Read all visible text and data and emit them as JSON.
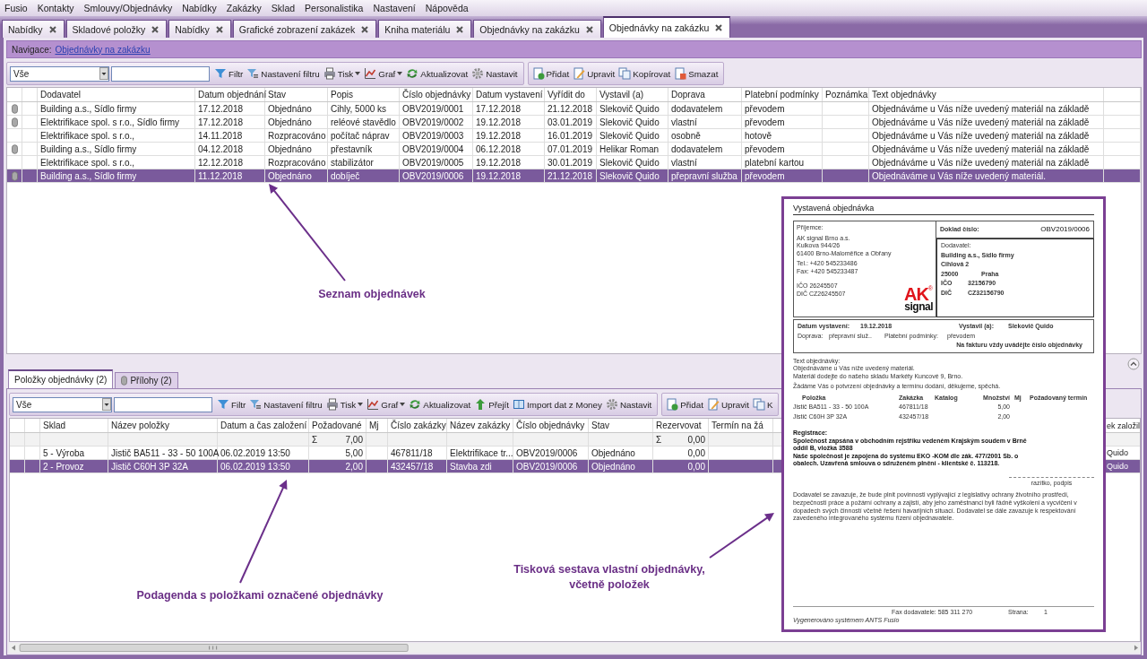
{
  "menu": [
    "Fusio",
    "Kontakty",
    "Smlouvy/Objednávky",
    "Nabídky",
    "Zakázky",
    "Sklad",
    "Personalistika",
    "Nastavení",
    "Nápověda"
  ],
  "tabs": [
    {
      "label": "Nabídky",
      "selected": false
    },
    {
      "label": "Skladové položky",
      "selected": false
    },
    {
      "label": "Nabídky",
      "selected": false
    },
    {
      "label": "Grafické zobrazení zakázek",
      "selected": false
    },
    {
      "label": "Kniha materiálu",
      "selected": false
    },
    {
      "label": "Objednávky na zakázku",
      "selected": false
    },
    {
      "label": "Objednávky na zakázku",
      "selected": true
    }
  ],
  "navigation": {
    "label": "Navigace:",
    "link": "Objednávky na zakázku"
  },
  "toolbar": {
    "filter_value": "Vše",
    "groups": [
      [
        {
          "label": "Filtr",
          "kind": "filter",
          "dropdown": false
        },
        {
          "label": "Nastavení filtru",
          "kind": "filter_settings",
          "dropdown": false
        },
        {
          "label": "Tisk",
          "kind": "print",
          "dropdown": true
        },
        {
          "label": "Graf",
          "kind": "chart",
          "dropdown": true
        },
        {
          "label": "Aktualizovat",
          "kind": "refresh",
          "dropdown": false
        },
        {
          "label": "Nastavit",
          "kind": "settings",
          "dropdown": false
        }
      ],
      [
        {
          "label": "Přidat",
          "kind": "add",
          "dropdown": false
        },
        {
          "label": "Upravit",
          "kind": "edit",
          "dropdown": false
        },
        {
          "label": "Kopírovat",
          "kind": "copy",
          "dropdown": false
        },
        {
          "label": "Smazat",
          "kind": "delete",
          "dropdown": false
        }
      ]
    ]
  },
  "orders": {
    "columns": [
      "Dodavatel",
      "Datum objednání",
      "Stav",
      "Popis",
      "Číslo objednávky",
      "Datum vystavení",
      "Vyřídit do",
      "Vystavil (a)",
      "Doprava",
      "Platební podmínky",
      "Poznámka",
      "Text objednávky"
    ],
    "rows": [
      {
        "attachment": true,
        "selected": false,
        "dodavatel": "Building a.s., Sídlo firmy",
        "datum_objednani": "17.12.2018",
        "stav": "Objednáno",
        "popis": "Cihly, 5000 ks",
        "cislo_objednavky": "OBV2019/0001",
        "datum_vystaveni": "17.12.2018",
        "vyridit_do": "21.12.2018",
        "vystavil": "Slekovič Quido",
        "doprava": "dodavatelem",
        "platebni_podminky": "převodem",
        "text_objednavky": "Objednáváme u Vás níže uvedený materiál na základě"
      },
      {
        "attachment": true,
        "selected": false,
        "dodavatel": "Elektrifikace spol. s r.o., Sídlo firmy",
        "datum_objednani": "17.12.2018",
        "stav": "Objednáno",
        "popis": "reléové stavědlo",
        "cislo_objednavky": "OBV2019/0002",
        "datum_vystaveni": "19.12.2018",
        "vyridit_do": "03.01.2019",
        "vystavil": "Slekovič Quido",
        "doprava": "vlastní",
        "platebni_podminky": "převodem",
        "text_objednavky": "Objednáváme u Vás níže uvedený materiál na základě"
      },
      {
        "attachment": false,
        "selected": false,
        "dodavatel": "Elektrifikace spol. s r.o.,",
        "datum_objednani": "14.11.2018",
        "stav": "Rozpracováno",
        "popis": "počítač náprav",
        "cislo_objednavky": "OBV2019/0003",
        "datum_vystaveni": "19.12.2018",
        "vyridit_do": "16.01.2019",
        "vystavil": "Slekovič Quido",
        "doprava": "osobně",
        "platebni_podminky": "hotově",
        "text_objednavky": "Objednáváme u Vás níže uvedený materiál na základě"
      },
      {
        "attachment": true,
        "selected": false,
        "dodavatel": "Building a.s., Sídlo firmy",
        "datum_objednani": "04.12.2018",
        "stav": "Objednáno",
        "popis": "přestavník",
        "cislo_objednavky": "OBV2019/0004",
        "datum_vystaveni": "06.12.2018",
        "vyridit_do": "07.01.2019",
        "vystavil": "Helikar Roman",
        "doprava": "dodavatelem",
        "platebni_podminky": "převodem",
        "text_objednavky": "Objednáváme u Vás níže uvedený materiál na základě"
      },
      {
        "attachment": false,
        "selected": false,
        "dodavatel": "Elektrifikace spol. s r.o.,",
        "datum_objednani": "12.12.2018",
        "stav": "Rozpracováno",
        "popis": "stabilizátor",
        "cislo_objednavky": "OBV2019/0005",
        "datum_vystaveni": "19.12.2018",
        "vyridit_do": "30.01.2019",
        "vystavil": "Slekovič Quido",
        "doprava": "vlastní",
        "platebni_podminky": "platební kartou",
        "text_objednavky": "Objednáváme u Vás níže uvedený materiál na základě"
      },
      {
        "attachment": true,
        "selected": true,
        "dodavatel": "Building a.s., Sídlo firmy",
        "datum_objednani": "11.12.2018",
        "stav": "Objednáno",
        "popis": "dobíječ",
        "cislo_objednavky": "OBV2019/0006",
        "datum_vystaveni": "19.12.2018",
        "vyridit_do": "21.12.2018",
        "vystavil": "Slekovič Quido",
        "doprava": "přepravní služba",
        "platebni_podminky": "převodem",
        "text_objednavky": "Objednáváme u Vás níže uvedený materiál."
      }
    ]
  },
  "detail_tabs": [
    {
      "label": "Položky objednávky (2)",
      "selected": true,
      "attachment": false
    },
    {
      "label": "Přílohy (2)",
      "selected": false,
      "attachment": true
    }
  ],
  "detail_toolbar": {
    "filter_value": "Vše",
    "groups": [
      [
        {
          "label": "Filtr",
          "kind": "filter",
          "dropdown": false
        },
        {
          "label": "Nastavení filtru",
          "kind": "filter_settings",
          "dropdown": false
        },
        {
          "label": "Tisk",
          "kind": "print",
          "dropdown": true
        },
        {
          "label": "Graf",
          "kind": "chart",
          "dropdown": true
        },
        {
          "label": "Aktualizovat",
          "kind": "refresh",
          "dropdown": false
        },
        {
          "label": "Přejít",
          "kind": "go",
          "dropdown": false
        },
        {
          "label": "Import dat z Money",
          "kind": "import",
          "dropdown": false
        },
        {
          "label": "Nastavit",
          "kind": "settings",
          "dropdown": false
        }
      ],
      [
        {
          "label": "Přidat",
          "kind": "add",
          "dropdown": false
        },
        {
          "label": "Upravit",
          "kind": "edit",
          "dropdown": false
        },
        {
          "label": "K",
          "kind": "copy",
          "dropdown": false
        }
      ]
    ]
  },
  "items": {
    "columns": [
      "Sklad",
      "Název položky",
      "Datum a čas založení",
      "Požadované",
      "Mj",
      "Číslo zakázky",
      "Název zakázky",
      "Číslo objednávky",
      "Stav",
      "Rezervovat",
      "Termín na žá",
      "ek založil"
    ],
    "sum_row": {
      "pozadovane": [
        "Σ",
        "7,00"
      ],
      "rezervovat": [
        "Σ",
        "0,00"
      ]
    },
    "rows": [
      {
        "selected": false,
        "sklad": "5 - Výroba",
        "nazev_polozky": "Jistič BA511 - 33 - 50 100A",
        "datum_zalozeni": "06.02.2019 13:50",
        "pozadovane": "5,00",
        "cislo_zakazky": "467811/18",
        "nazev_zakazky": "Elektrifikace tr...",
        "cislo_objednavky": "OBV2019/0006",
        "stav": "Objednáno",
        "rezervovat": "0,00",
        "zalozil": "Quido"
      },
      {
        "selected": true,
        "sklad": "2 - Provoz",
        "nazev_polozky": "Jistič C60H 3P 32A",
        "datum_zalozeni": "06.02.2019 13:50",
        "pozadovane": "2,00",
        "cislo_zakazky": "432457/18",
        "nazev_zakazky": "Stavba zdi",
        "cislo_objednavky": "OBV2019/0006",
        "stav": "Objednáno",
        "rezervovat": "0,00",
        "zalozil": "Quido"
      }
    ]
  },
  "annotations": [
    {
      "lines": [
        "Seznam objednávek"
      ]
    },
    {
      "lines": [
        "Podagenda s položkami označené objednávky"
      ]
    },
    {
      "lines": [
        "Tisková sestava vlastní objednávky,",
        "včetně položek"
      ]
    }
  ],
  "print_preview": {
    "title": "Vystavená objednávka",
    "recipient": {
      "label": "Příjemce:",
      "address": [
        "AK signal Brno a.s.",
        "Kulkova 944/26",
        "61400 Brno-Maloměřice a Obřany"
      ],
      "contacts": [
        "Tel.: +420 545233486",
        "Fax: +420 545233487"
      ],
      "ids": [
        "IČO 26245507",
        "DIČ CZ26245507"
      ]
    },
    "logo": {
      "top": "AK",
      "bottom": "signal",
      "mark": "®"
    },
    "document_number": {
      "label": "Doklad číslo:",
      "value": "OBV2019/0006"
    },
    "supplier": {
      "label": "Dodavatel:",
      "name": "Building a.s., Sídlo firmy",
      "street": "Cihlová 2",
      "zip": "25000",
      "city": "Praha",
      "ico_label": "IČO",
      "ico": "32156790",
      "dic_label": "DIČ",
      "dic": "CZ32156790"
    },
    "details": {
      "issue_date_label": "Datum vystavení:",
      "issue_date": "19.12.2018",
      "issued_by_label": "Vystavil (a):",
      "issued_by": "Slekovič Quido",
      "transport_label": "Doprava:",
      "transport": "přepravní služ..",
      "payment_label": "Platební podmínky:",
      "payment": "převodem",
      "note": "Na fakturu vždy uvádějte číslo objednávky"
    },
    "text_label": "Text objednávky:",
    "text_lines": [
      "Objednáváme u Vás níže uvedený materiál.",
      "Materiál dodejte do našeho skladu Markéty Kuncové 9, Brno."
    ],
    "request": "Žádáme Vás o potvrzení objednávky a termínu dodání, děkujeme, spěchá.",
    "item_columns": [
      "Položka",
      "Zakázka",
      "Katalog",
      "Množství",
      "Mj",
      "Požadovaný termín"
    ],
    "items": [
      {
        "name": "Jistič BA511 - 33 - 50 100A",
        "order": "467811/18",
        "quantity": "5,00"
      },
      {
        "name": "Jistič C60H 3P 32A",
        "order": "432457/18",
        "quantity": "2,00"
      }
    ],
    "registration": [
      "Registrace:",
      "Společnost zapsána v obchodním rejstříku vedeném Krajským soudem v Brně",
      "oddíl B, vložka 3588",
      "Naše společnost je zapojena do systému EKO -KOM dle zák. 477/2001 Sb. o",
      "obalech. Uzavřená smlouva o sdruženém plnění - klientské č. 113218."
    ],
    "signature": "razítko, podpis",
    "disclaimer": "Dodavatel se zavazuje, že bude plnit povinnosti vyplývající z legislativy ochrany životního prostředí, bezpečnosti práce a požární ochrany a zajistí, aby jeho zaměstnanci byli řádně vyškoleni a vycvičeni v dopadech svých činností včetně řešení havarijních situací. Dodavatel se dále zavazuje k respektování zavedeného integrovaného systému řízení objednavatele.",
    "fax": "Fax dodavatele: 585 311 270",
    "page_label": "Strana:",
    "page": "1",
    "generated": "Vygenerováno systémem ANTS Fusio"
  }
}
